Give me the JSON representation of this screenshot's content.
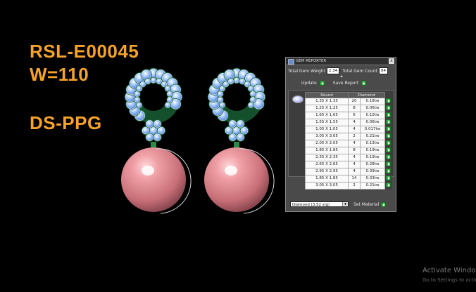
{
  "overlay": {
    "line1": "RSL-E00045",
    "line2": "W=110",
    "line3": "DS-PPG",
    "color": "#f5a32a"
  },
  "gem_reporter": {
    "title": "GEM REPORTER",
    "close": "x",
    "total_weight_label": "Total Gem Weight",
    "total_weight_value": "2.34",
    "total_count_label": "Total Gem Count",
    "total_count_value": "84",
    "update_label": "Update",
    "save_report_label": "Save Report",
    "columns": [
      "Round",
      "Diamond"
    ],
    "rows": [
      {
        "size": "1.35 X 1.35",
        "count": "20",
        "weight": "0.18tw"
      },
      {
        "size": "1.25 X 1.25",
        "count": "8",
        "weight": "0.06tw"
      },
      {
        "size": "1.65 X 1.65",
        "count": "6",
        "weight": "0.10tw"
      },
      {
        "size": "1.55 X 1.55",
        "count": "4",
        "weight": "0.06tw"
      },
      {
        "size": "1.05 X 1.05",
        "count": "4",
        "weight": "0.017tw"
      },
      {
        "size": "3.05 X 3.05",
        "count": "2",
        "weight": "0.21tw"
      },
      {
        "size": "2.05 X 2.05",
        "count": "4",
        "weight": "0.13tw"
      },
      {
        "size": "1.85 X 1.85",
        "count": "8",
        "weight": "0.19tw"
      },
      {
        "size": "2.35 X 2.35",
        "count": "4",
        "weight": "0.19tw"
      },
      {
        "size": "2.65 X 2.65",
        "count": "4",
        "weight": "0.28tw"
      },
      {
        "size": "2.95 X 2.95",
        "count": "4",
        "weight": "0.39tw"
      },
      {
        "size": "1.85 X 1.85",
        "count": "14",
        "weight": "0.33tw"
      },
      {
        "size": "3.05 X 3.05",
        "count": "2",
        "weight": "0.21tw"
      }
    ],
    "material_select": "Diamond   (3.52 s/g)",
    "set_material_label": "Set Material",
    "accent_green": "#3bb34a"
  },
  "os_watermark": {
    "line1": "Activate Window",
    "line2": "Go to Settings to activ"
  }
}
